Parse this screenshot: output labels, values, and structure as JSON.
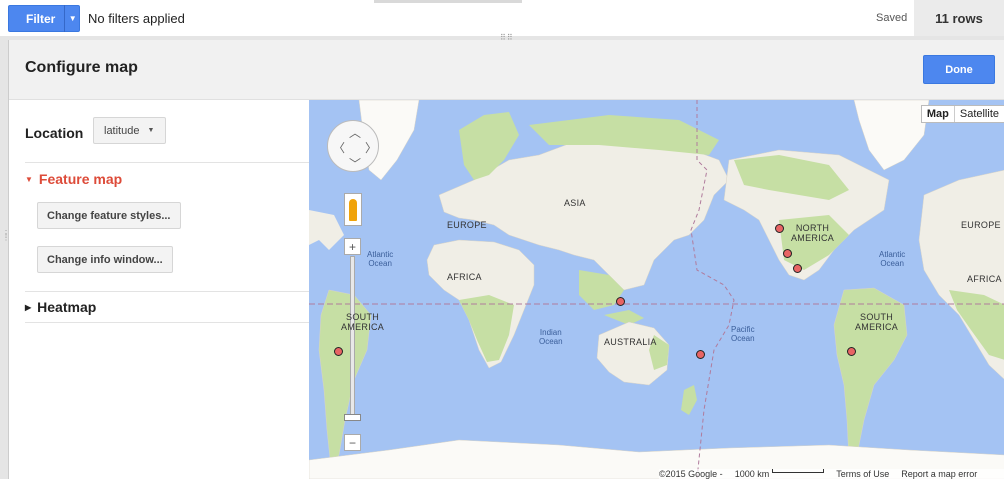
{
  "topbar": {
    "filter_label": "Filter",
    "filter_status": "No filters applied",
    "saved_label": "Saved",
    "row_count": "11 rows"
  },
  "dialog": {
    "title": "Configure map",
    "done_label": "Done"
  },
  "panel": {
    "location_label": "Location",
    "location_value": "latitude",
    "feature_map_label": "Feature map",
    "change_styles_label": "Change feature styles...",
    "change_info_label": "Change info window...",
    "heatmap_label": "Heatmap"
  },
  "map": {
    "map_type_map": "Map",
    "map_type_satellite": "Satellite",
    "labels": {
      "asia": "ASIA",
      "europe": "EUROPE",
      "africa": "AFRICA",
      "australia": "AUSTRALIA",
      "north_america": "NORTH\nAMERICA",
      "south_america_left": "SOUTH\nAMERICA",
      "south_america_right": "SOUTH\nAMERICA",
      "atlantic_left": "Atlantic\nOcean",
      "atlantic_right": "Atlantic\nOcean",
      "indian": "Indian\nOcean",
      "pacific": "Pacific\nOcean",
      "africa_right": "AFRICA",
      "europe_right": "EUROPE"
    },
    "marker_count": 7,
    "attribution": {
      "copyright": "©2015 Google -",
      "scale": "1000 km",
      "terms": "Terms of Use",
      "report": "Report a map error"
    }
  },
  "colors": {
    "accent_blue": "#4d87ef",
    "feature_red": "#dd4b39",
    "marker_red": "#e86464",
    "water": "#a4c3f3",
    "land": "#f0eee6",
    "vegetation": "#c6dfa4"
  }
}
